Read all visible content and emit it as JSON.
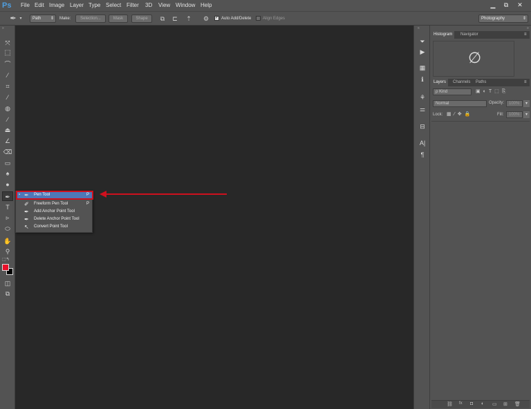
{
  "app": {
    "logo": "Ps"
  },
  "menu": [
    "File",
    "Edit",
    "Image",
    "Layer",
    "Type",
    "Select",
    "Filter",
    "3D",
    "View",
    "Window",
    "Help"
  ],
  "window_controls": {
    "minimize": "▁",
    "restore": "⧉",
    "close": "✕"
  },
  "options_bar": {
    "mode_select": "Path",
    "make_label": "Make:",
    "selection_btn": "Selection...",
    "mask_btn": "Mask",
    "shape_btn": "Shape",
    "auto_add_delete": "Auto Add/Delete",
    "align_edges": "Align Edges",
    "workspace": "Photography"
  },
  "flyout": {
    "items": [
      {
        "label": "Pen Tool",
        "key": "P",
        "icon": "pen-icon"
      },
      {
        "label": "Freeform Pen Tool",
        "key": "P",
        "icon": "freeform-pen-icon"
      },
      {
        "label": "Add Anchor Point Tool",
        "key": "",
        "icon": "add-anchor-icon"
      },
      {
        "label": "Delete Anchor Point Tool",
        "key": "",
        "icon": "delete-anchor-icon"
      },
      {
        "label": "Convert Point Tool",
        "key": "",
        "icon": "convert-point-icon"
      }
    ]
  },
  "panels": {
    "top_tabs": [
      "Histogram",
      "Navigator"
    ],
    "no_image_symbol": "∅",
    "layers_tabs": [
      "Layers",
      "Channels",
      "Paths"
    ],
    "kind_filter": "ρ Kind",
    "blend_mode": "Normal",
    "opacity_label": "Opacity:",
    "opacity_value": "100%",
    "lock_label": "Lock:",
    "fill_label": "Fill:",
    "fill_value": "100%"
  },
  "colors": {
    "foreground": "#e8102a",
    "background": "#000000",
    "annotation": "#d0101e",
    "highlight": "#4e78b8"
  }
}
